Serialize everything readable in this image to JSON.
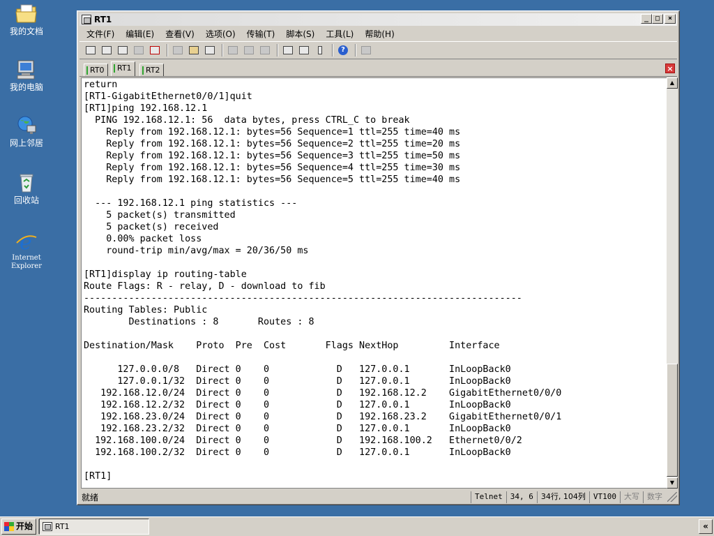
{
  "desktop": {
    "icons": [
      {
        "label": "我的文档"
      },
      {
        "label": "我的电脑"
      },
      {
        "label": "网上邻居"
      },
      {
        "label": "回收站"
      },
      {
        "label_line1": "Internet",
        "label_line2": "Explorer"
      }
    ]
  },
  "window": {
    "title": "RT1",
    "buttons": {
      "minimize": "_",
      "maximize": "□",
      "close": "×"
    }
  },
  "menu": [
    "文件(F)",
    "编辑(E)",
    "查看(V)",
    "选项(O)",
    "传输(T)",
    "脚本(S)",
    "工具(L)",
    "帮助(H)"
  ],
  "toolbar_icons": [
    "connect-icon",
    "quick-connect-icon",
    "connect-tab-icon",
    "reconnect-icon",
    "disconnect-icon",
    "copy-icon",
    "paste-icon",
    "find-icon",
    "print-icon",
    "print-setup-icon",
    "print-screen-icon",
    "session-options-icon",
    "global-options-icon",
    "keymap-icon",
    "help-icon",
    "sftp-icon"
  ],
  "tabs": [
    {
      "label": "RT0",
      "active": false
    },
    {
      "label": "RT1",
      "active": true
    },
    {
      "label": "RT2",
      "active": false
    }
  ],
  "terminal": {
    "lines": [
      "return",
      "[RT1-GigabitEthernet0/0/1]quit",
      "[RT1]ping 192.168.12.1",
      "  PING 192.168.12.1: 56  data bytes, press CTRL_C to break",
      "    Reply from 192.168.12.1: bytes=56 Sequence=1 ttl=255 time=40 ms",
      "    Reply from 192.168.12.1: bytes=56 Sequence=2 ttl=255 time=20 ms",
      "    Reply from 192.168.12.1: bytes=56 Sequence=3 ttl=255 time=50 ms",
      "    Reply from 192.168.12.1: bytes=56 Sequence=4 ttl=255 time=30 ms",
      "    Reply from 192.168.12.1: bytes=56 Sequence=5 ttl=255 time=40 ms",
      "",
      "  --- 192.168.12.1 ping statistics ---",
      "    5 packet(s) transmitted",
      "    5 packet(s) received",
      "    0.00% packet loss",
      "    round-trip min/avg/max = 20/36/50 ms",
      "",
      "[RT1]display ip routing-table",
      "Route Flags: R - relay, D - download to fib",
      "------------------------------------------------------------------------------",
      "Routing Tables: Public",
      "        Destinations : 8       Routes : 8",
      "",
      "Destination/Mask    Proto  Pre  Cost       Flags NextHop         Interface",
      "",
      "      127.0.0.0/8   Direct 0    0            D   127.0.0.1       InLoopBack0",
      "      127.0.0.1/32  Direct 0    0            D   127.0.0.1       InLoopBack0",
      "   192.168.12.0/24  Direct 0    0            D   192.168.12.2    GigabitEthernet0/0/0",
      "   192.168.12.2/32  Direct 0    0            D   127.0.0.1       InLoopBack0",
      "   192.168.23.0/24  Direct 0    0            D   192.168.23.2    GigabitEthernet0/0/1",
      "   192.168.23.2/32  Direct 0    0            D   127.0.0.1       InLoopBack0",
      "  192.168.100.0/24  Direct 0    0            D   192.168.100.2   Ethernet0/0/2",
      "  192.168.100.2/32  Direct 0    0            D   127.0.0.1       InLoopBack0",
      "",
      "[RT1]"
    ]
  },
  "status": {
    "text": "就绪",
    "protocol": "Telnet",
    "cursor": "34,   6",
    "size": "34行, 104列",
    "emulation": "VT100",
    "caps": "大写",
    "num": "数字"
  },
  "taskbar": {
    "start_label": "开始",
    "task_label": "RT1",
    "tray_label": "«"
  }
}
